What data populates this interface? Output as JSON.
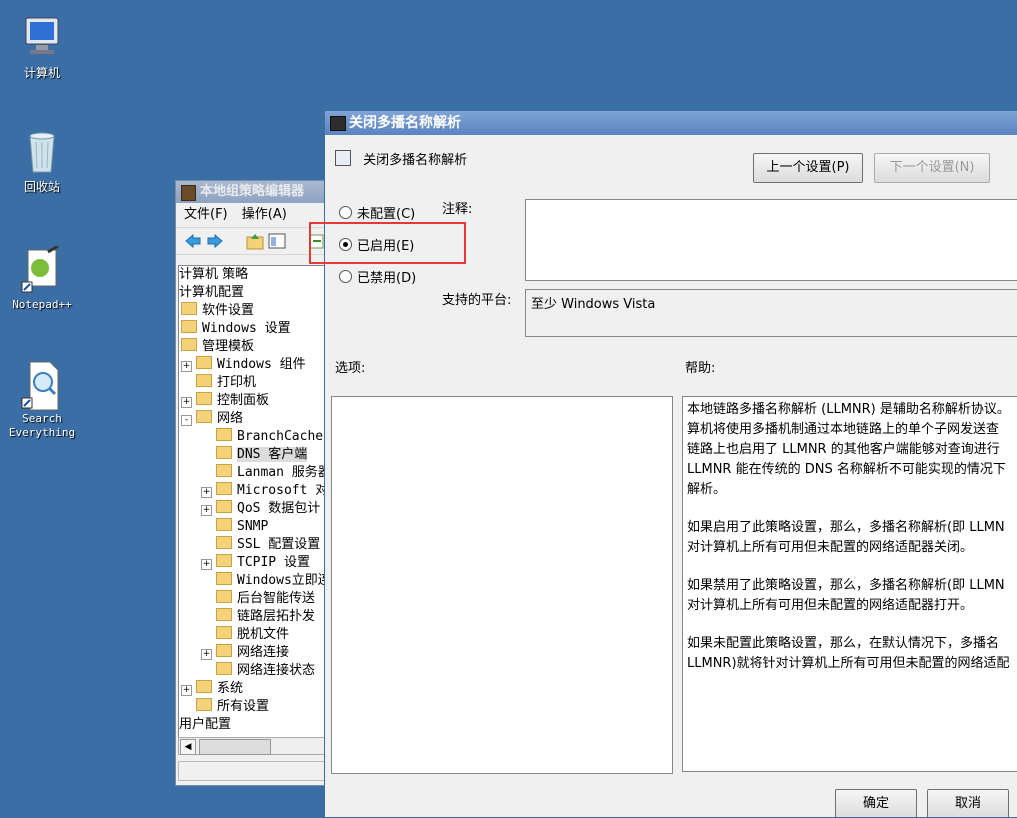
{
  "desktop": {
    "icons": [
      {
        "label": "计算机",
        "icon": "computer-icon"
      },
      {
        "label": "回收站",
        "icon": "recycle-bin-icon"
      },
      {
        "label": "Notepad++",
        "icon": "notepad-plus-plus-icon"
      },
      {
        "label": "Search\nEverything",
        "icon": "search-everything-icon"
      }
    ]
  },
  "gpe": {
    "title": "本地组策略编辑器",
    "menu": [
      "文件(F)",
      "操作(A)"
    ],
    "tree": [
      {
        "label": "计算机 策略",
        "level": 0
      },
      {
        "label": "计算机配置",
        "level": 0
      },
      {
        "label": "软件设置",
        "level": 1
      },
      {
        "label": "Windows 设置",
        "level": 1
      },
      {
        "label": "管理模板",
        "level": 1
      },
      {
        "label": "Windows 组件",
        "level": 2,
        "expander": "+"
      },
      {
        "label": "打印机",
        "level": 2
      },
      {
        "label": "控制面板",
        "level": 2,
        "expander": "+"
      },
      {
        "label": "网络",
        "level": 2,
        "expander": "-"
      },
      {
        "label": "BranchCache",
        "level": 3
      },
      {
        "label": "DNS 客户端",
        "level": 3,
        "selected": true
      },
      {
        "label": "Lanman 服务器",
        "level": 3
      },
      {
        "label": "Microsoft 对",
        "level": 3,
        "expander": "+"
      },
      {
        "label": "QoS 数据包计",
        "level": 3,
        "expander": "+"
      },
      {
        "label": "SNMP",
        "level": 3
      },
      {
        "label": "SSL 配置设置",
        "level": 3
      },
      {
        "label": "TCPIP 设置",
        "level": 3,
        "expander": "+"
      },
      {
        "label": "Windows立即连",
        "level": 3
      },
      {
        "label": "后台智能传送",
        "level": 3
      },
      {
        "label": "链路层拓扑发",
        "level": 3
      },
      {
        "label": "脱机文件",
        "level": 3
      },
      {
        "label": "网络连接",
        "level": 3,
        "expander": "+"
      },
      {
        "label": "网络连接状态",
        "level": 3
      },
      {
        "label": "系统",
        "level": 2,
        "expander": "+"
      },
      {
        "label": "所有设置",
        "level": 2
      },
      {
        "label": "用户配置",
        "level": 0
      }
    ]
  },
  "dialog": {
    "title": "关闭多播名称解析",
    "policy_name": "关闭多播名称解析",
    "prev_button": "上一个设置(P)",
    "next_button": "下一个设置(N)",
    "options": [
      {
        "label": "未配置(C)",
        "checked": false
      },
      {
        "label": "已启用(E)",
        "checked": true
      },
      {
        "label": "已禁用(D)",
        "checked": false
      }
    ],
    "comment_label": "注释:",
    "comment_value": "",
    "platform_label": "支持的平台:",
    "platform_value": "至少 Windows Vista",
    "options_label": "选项:",
    "help_label": "帮助:",
    "help_paragraphs": [
      "本地链路多播名称解析 (LLMNR) 是辅助名称解析协议。\n算机将使用多播机制通过本地链路上的单个子网发送查\n链路上也启用了 LLMNR 的其他客户端能够对查询进行\nLLMNR 能在传统的 DNS 名称解析不可能实现的情况下\n解析。",
      "如果启用了此策略设置，那么，多播名称解析(即 LLMN\n对计算机上所有可用但未配置的网络适配器关闭。",
      "如果禁用了此策略设置，那么，多播名称解析(即 LLMN\n对计算机上所有可用但未配置的网络适配器打开。",
      "如果未配置此策略设置，那么，在默认情况下，多播名\nLLMNR)就将针对计算机上所有可用但未配置的网络适配"
    ],
    "ok_button": "确定",
    "cancel_button": "取消"
  },
  "colors": {
    "desktop": "#3a6ea5",
    "highlight": "#e53935"
  }
}
